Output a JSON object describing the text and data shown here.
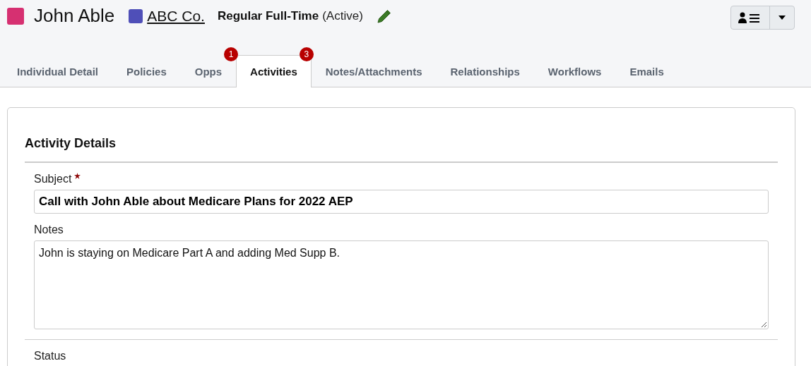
{
  "header": {
    "person": {
      "name": "John Able",
      "color": "#d63071"
    },
    "company": {
      "name": "ABC Co.",
      "color": "#4f4fb8"
    },
    "employment": {
      "type": "Regular Full-Time",
      "status": "(Active)"
    }
  },
  "tabs": [
    {
      "label": "Individual Detail",
      "selected": false
    },
    {
      "label": "Policies",
      "selected": false
    },
    {
      "label": "Opps",
      "selected": false,
      "badge": "1"
    },
    {
      "label": "Activities",
      "selected": true,
      "badge": "3"
    },
    {
      "label": "Notes/Attachments",
      "selected": false
    },
    {
      "label": "Relationships",
      "selected": false
    },
    {
      "label": "Workflows",
      "selected": false
    },
    {
      "label": "Emails",
      "selected": false
    }
  ],
  "section": {
    "title": "Activity Details"
  },
  "fields": [
    {
      "label": "Subject",
      "required": true,
      "kind": "input",
      "value": "Call with John Able about Medicare Plans for 2022 AEP"
    },
    {
      "label": "Notes",
      "required": false,
      "kind": "textarea",
      "value": "John is staying on Medicare Part A and adding Med Supp B."
    },
    {
      "label": "Status",
      "required": false,
      "kind": "cut"
    }
  ]
}
